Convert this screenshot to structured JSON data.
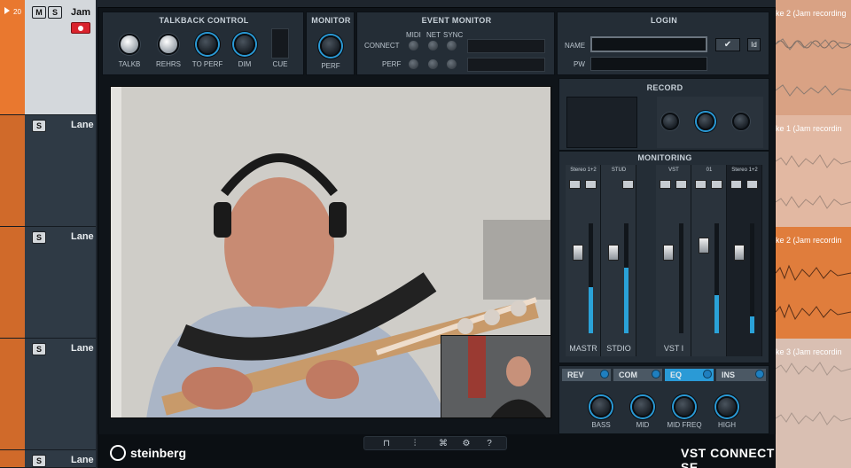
{
  "tracks": {
    "items": [
      {
        "number": "20",
        "mute": "M",
        "solo": "S",
        "name": "Jam"
      },
      {
        "solo": "S",
        "name": "Lane"
      },
      {
        "solo": "S",
        "name": "Lane"
      },
      {
        "solo": "S",
        "name": "Lane"
      },
      {
        "solo": "S",
        "name": "Lane"
      }
    ]
  },
  "arrangement": {
    "lanes": [
      {
        "label": "ke 2 (Jam recording"
      },
      {
        "label": "ke 1 (Jam recordin"
      },
      {
        "label": "ke 2 (Jam recordin"
      },
      {
        "label": "ke 3 (Jam recordin"
      }
    ]
  },
  "talkback": {
    "title": "TALKBACK CONTROL",
    "knobs": [
      {
        "label": "TALKB"
      },
      {
        "label": "REHRS"
      },
      {
        "label": "TO PERF"
      },
      {
        "label": "DIM"
      }
    ],
    "cue_label": "CUE"
  },
  "monitor": {
    "title": "MONITOR",
    "knob_label": "PERF"
  },
  "event_monitor": {
    "title": "EVENT MONITOR",
    "columns": [
      "MIDI",
      "NET",
      "SYNC"
    ],
    "rows": [
      "CONNECT",
      "PERF"
    ]
  },
  "login": {
    "title": "LOGIN",
    "name_label": "NAME",
    "pw_label": "PW",
    "name_value": "",
    "pw_value": "",
    "confirm_icon": "check-icon",
    "id_button": "Id"
  },
  "record": {
    "title": "RECORD"
  },
  "monitoring": {
    "title": "MONITORING",
    "channels": [
      {
        "route": "Stereo 1+2",
        "label": "MASTR",
        "level": 0.42
      },
      {
        "route": "STUD",
        "label": "STDIO",
        "level": 0.6
      },
      {
        "route": "VST",
        "label": "VST I",
        "level": 0.0
      },
      {
        "route": "01",
        "label": "",
        "level": 0.35
      },
      {
        "route": "Stereo 1+2",
        "label": "",
        "level": 0.15
      }
    ],
    "fx_tabs": [
      {
        "label": "REV",
        "active": false
      },
      {
        "label": "COM",
        "active": false
      },
      {
        "label": "EQ",
        "active": true
      },
      {
        "label": "INS",
        "active": false
      }
    ],
    "eq_knobs": [
      {
        "label": "BASS"
      },
      {
        "label": "MID"
      },
      {
        "label": "MID FREQ"
      },
      {
        "label": "HIGH"
      }
    ]
  },
  "bottom": {
    "brand": "steinberg",
    "product": "VST CONNECT SE",
    "tools": [
      {
        "icon": "routing-icon",
        "glyph": "⊓"
      },
      {
        "icon": "mixer-icon",
        "glyph": "⫶"
      },
      {
        "icon": "network-icon",
        "glyph": "⌘"
      },
      {
        "icon": "settings-icon",
        "glyph": "⚙"
      },
      {
        "icon": "help-icon",
        "glyph": "?"
      }
    ]
  },
  "colors": {
    "accent": "#2a9ad6",
    "track": "#e9782f",
    "record": "#d9232d"
  }
}
